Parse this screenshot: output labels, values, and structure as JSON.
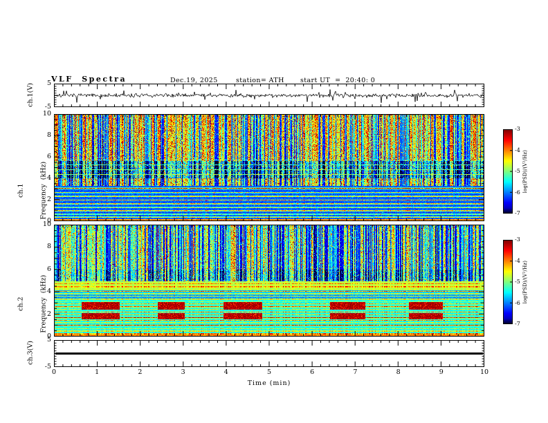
{
  "header": {
    "title": "VLF  Spectra",
    "date": "Dec.19, 2025",
    "station": "station= ATH",
    "start_ut": "start UT  =  20:40: 0"
  },
  "axes": {
    "xlabel": "Time  (min)",
    "xlim": [
      0,
      10
    ],
    "xticks": [
      0,
      1,
      2,
      3,
      4,
      5,
      6,
      7,
      8,
      9,
      10
    ],
    "x_minor_step_min": 0.2
  },
  "colorbar": {
    "label": "log(PSD)/(V²/Hz)",
    "ticks": [
      -3,
      -4,
      -5,
      -6,
      -7
    ],
    "range": [
      -7,
      -3
    ],
    "colormap": "jet"
  },
  "chart_data": [
    {
      "id": "ch1_waveform",
      "type": "line",
      "ylabel": "ch.1(V)",
      "ylim": [
        -5,
        5
      ],
      "yticks": [
        5,
        -5
      ],
      "summary": "continuous broadband noise centred on 0 V, typical amplitude about ±1 V with frequent impulsive spikes reaching about ±4 V over the full 0-10 min record"
    },
    {
      "id": "ch1_spectrogram",
      "type": "heatmap",
      "ylabel_line1": "ch.1",
      "ylabel_line2": "Frequency  (kHz)",
      "ylim": [
        0,
        10
      ],
      "yticks": [
        0,
        2,
        4,
        6,
        8,
        10
      ],
      "zlim": [
        -7,
        -3
      ],
      "summary": "dark-blue low-PSD background; dense vertical broadband sferic streaks (cyan/green/yellow) from about 3.5 up to 10 kHz; darker navy band between 4 and 5.6 kHz; quasi-continuous horizontal emission lines (cyan/green) below about 3.3 kHz; bright narrow line at 0 kHz"
    },
    {
      "id": "ch2_spectrogram",
      "type": "heatmap",
      "ylabel_line1": "ch.2",
      "ylabel_line2": "Frequency  (kHz)",
      "ylim": [
        0,
        10
      ],
      "yticks": [
        0,
        2,
        4,
        6,
        8,
        10
      ],
      "zlim": [
        -7,
        -3
      ],
      "summary": "vertical sferic streaks above about 5 kHz on blue background; solid green-yellow band at 4.2-4.9 kHz; strong stack of horizontal harmonic lines (green/yellow/orange) from 0 to about 4.2 kHz with recurring dark-red interference patches near 1.6-3 kHz; bright narrow line at 0 kHz"
    },
    {
      "id": "ch3_waveform",
      "type": "line",
      "ylabel": "ch.3(V)",
      "ylim": [
        -5,
        5
      ],
      "yticks": [
        5,
        -5
      ],
      "summary": "flat heavy line at 0 V for the entire record (channel inactive)"
    }
  ]
}
